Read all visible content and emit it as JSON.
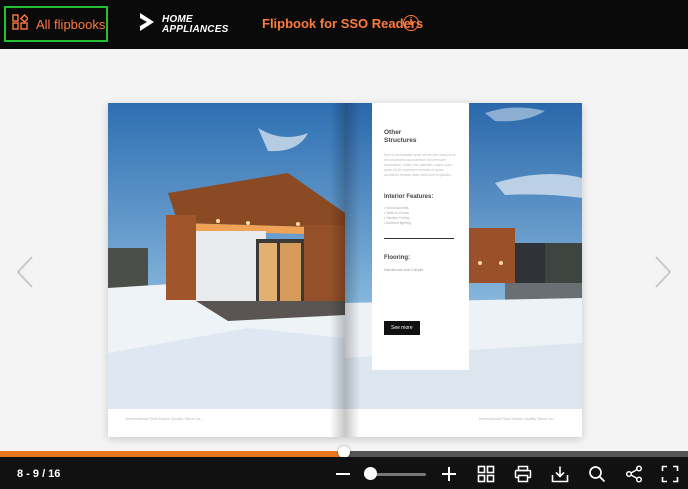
{
  "header": {
    "all_flipbooks_label": "All flipbooks",
    "logo_line1": "HOME",
    "logo_line2": "APPLIANCES",
    "title": "Flipbook for SSO Readers",
    "info_glyph": "i"
  },
  "book": {
    "left_footer": "International Real Estate Quality Since no...",
    "right_footer": "International Real Estate Quality Since no...",
    "card": {
      "heading_line1": "Other",
      "heading_line2": "Structures",
      "intro": "Sed ut perspiciatis unde omnis iste natus error sit voluptatem accusantium doloremque laudantium, totam rem aperiam, eaque ipsa quae ab illo inventore veritatis et quasi architecto beatae vitae dicta sunt explicabo.",
      "interior_heading": "Interior Features:",
      "interior_items": [
        "• Wood Accents",
        "• Walk-in Closet",
        "• Vaulted Ceiling",
        "• Ambient lighting"
      ],
      "flooring_heading": "Flooring:",
      "flooring_value": "Hardwood and Carpet",
      "button_label": "See more"
    }
  },
  "progress": {
    "fraction": 0.5
  },
  "bottom": {
    "page_indicator": "8 - 9 / 16",
    "zoom_fraction": 0.1,
    "icons": [
      "zoom-out-icon",
      "zoom-in-icon",
      "thumbnails-icon",
      "print-icon",
      "download-icon",
      "search-icon",
      "share-icon",
      "fullscreen-icon"
    ]
  },
  "colors": {
    "accent": "#ff7a3d",
    "progress": "#e8761f",
    "focus_outline": "#22c12f",
    "bar": "#111111"
  }
}
